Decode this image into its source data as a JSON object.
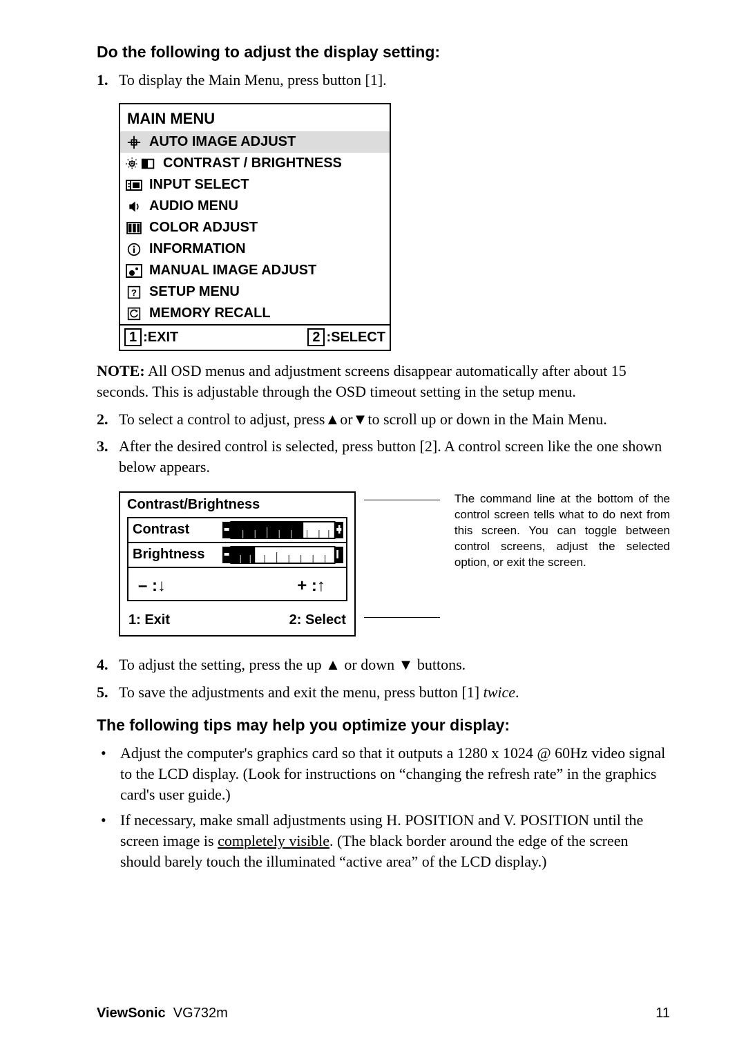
{
  "head1": "Do the following to adjust the display setting:",
  "step1_num": "1.",
  "step1_text": "To display the Main Menu, press button [1].",
  "mainmenu": {
    "title": "MAIN MENU",
    "items": [
      "AUTO IMAGE ADJUST",
      "CONTRAST / BRIGHTNESS",
      "INPUT SELECT",
      "AUDIO MENU",
      "COLOR ADJUST",
      "INFORMATION",
      "MANUAL IMAGE ADJUST",
      "SETUP MENU",
      "MEMORY RECALL"
    ],
    "foot_left_key": "1",
    "foot_left_label": ":EXIT",
    "foot_right_key": "2",
    "foot_right_label": ":SELECT"
  },
  "note_prefix": "NOTE:",
  "note_body": " All OSD menus and adjustment screens disappear automatically after about 15 seconds. This is adjustable through the OSD timeout setting in the setup menu.",
  "step2_num": "2.",
  "step2_a": "To select a control to adjust, press",
  "step2_b": "or",
  "step2_c": "to scroll up or down in the Main Menu.",
  "step3_num": "3.",
  "step3_text": "After the desired control is selected, press button [2]. A control screen like the one shown below appears.",
  "cb": {
    "title": "Contrast/Brightness",
    "row1": "Contrast",
    "row2": "Brightness",
    "minus": "– :",
    "plus": "+ :",
    "exit": "1: Exit",
    "select": "2: Select"
  },
  "callout_text": "The command line at the bottom of the control screen tells what to do next from this screen. You can toggle between control screens, adjust the selected option, or exit the screen.",
  "step4_num": "4.",
  "step4_a": "To adjust the setting, press the up ",
  "step4_b": " or down ",
  "step4_c": " buttons.",
  "step5_num": "5.",
  "step5_a": "To save the adjustments and exit the menu, press button [1] ",
  "step5_twice": "twice",
  "step5_b": ".",
  "head2": "The following tips may help you optimize your display:",
  "tip1": "Adjust the computer's graphics card so that it outputs a 1280 x 1024 @ 60Hz video signal to the LCD display. (Look for instructions on “changing the refresh rate” in the graphics card's user guide.)",
  "tip2_a": "If necessary, make small adjustments using H. POSITION and V. POSITION until the screen image is ",
  "tip2_u": "completely visible",
  "tip2_b": ". (The black border around the edge of the screen should barely touch the illuminated “active area” of the LCD display.)",
  "footer_brand": "ViewSonic",
  "footer_model": "VG732m",
  "footer_page": "11",
  "up_tri": "▲",
  "down_tri": "▼",
  "up_arrow": "↑",
  "down_arrow": "↓"
}
